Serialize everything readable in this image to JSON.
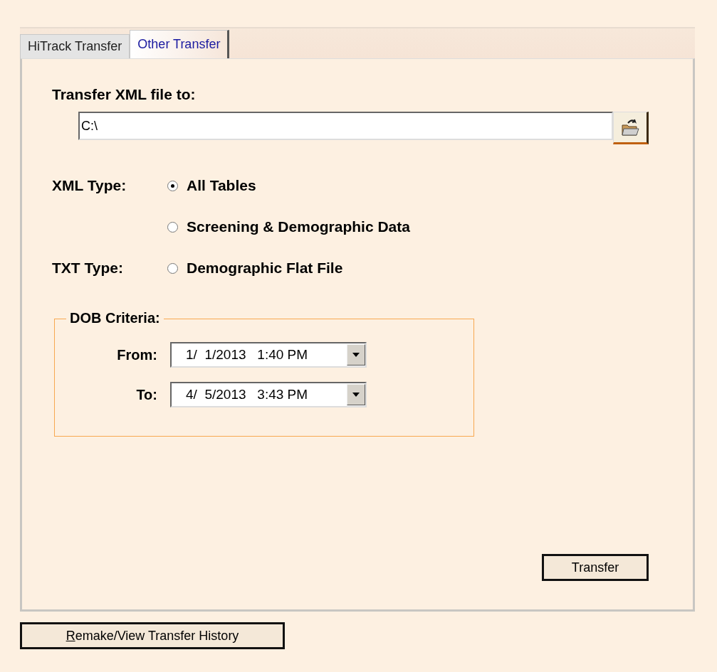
{
  "tabs": [
    {
      "label": "HiTrack Transfer",
      "selected": false
    },
    {
      "label": "Other Transfer",
      "selected": true
    }
  ],
  "destination": {
    "label": "Transfer XML file to:",
    "value": "C:\\"
  },
  "type_rows": [
    {
      "label": "XML Type:",
      "option": "All Tables",
      "selected": true
    },
    {
      "option": "Screening & Demographic Data",
      "selected": false
    },
    {
      "label": "TXT Type:",
      "option": "Demographic Flat File",
      "selected": false
    }
  ],
  "dob_criteria": {
    "legend": "DOB Criteria:",
    "fields": [
      {
        "label": "From:",
        "value": "1/  1/2013   1:40 PM"
      },
      {
        "label": "To:",
        "value": "4/  5/2013   3:43 PM"
      }
    ]
  },
  "transfer_button": "Transfer",
  "history_button": {
    "label": "Remake/View Transfer History",
    "first_letter_underlined": true
  }
}
